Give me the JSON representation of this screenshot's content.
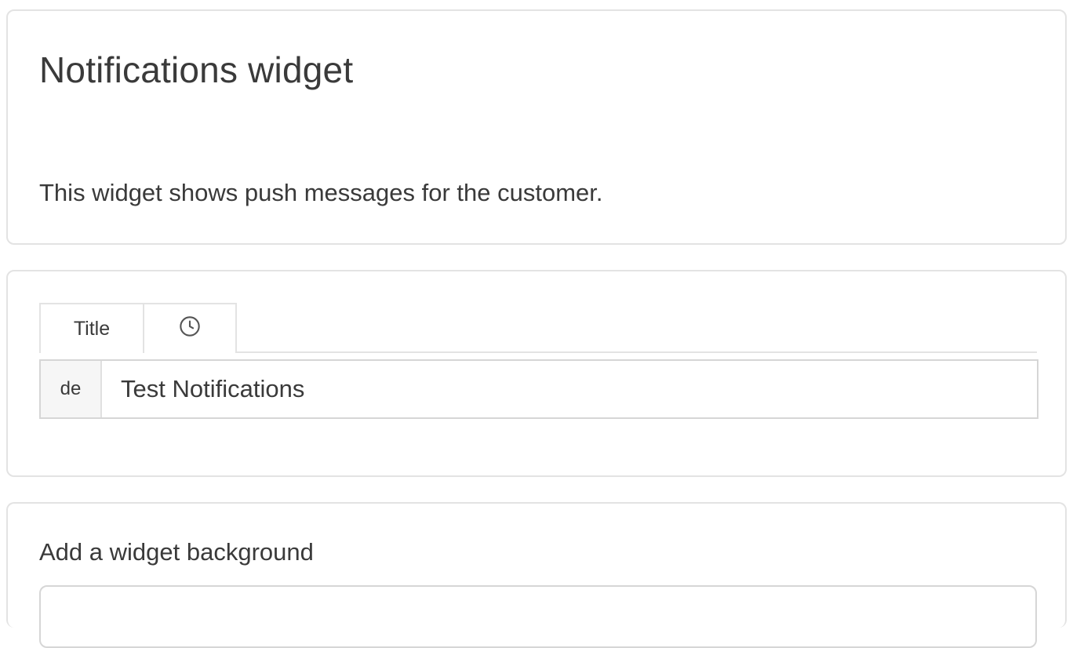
{
  "header": {
    "title": "Notifications widget",
    "description": "This widget shows push messages for the customer."
  },
  "title_section": {
    "tabs": [
      {
        "label": "Title"
      },
      {
        "icon": "clock-icon"
      }
    ],
    "language_code": "de",
    "title_value": "Test Notifications"
  },
  "background_section": {
    "label": "Add a widget background"
  },
  "colors": {
    "border": "#e3e3e3",
    "text": "#3a3a3a",
    "addon_bg": "#f6f6f6"
  }
}
